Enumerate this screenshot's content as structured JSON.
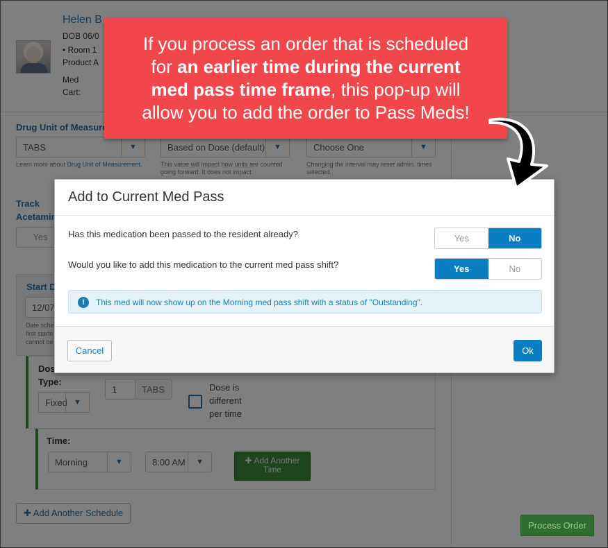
{
  "resident": {
    "name": "Helen B",
    "dob": "DOB 06/0",
    "room": "• Room 1",
    "product": "Product A",
    "med_label": "Med",
    "cart_label": "Cart:"
  },
  "order_form": {
    "drug_unit_label": "Drug Unit of Measure",
    "drug_unit_value": "TABS",
    "drug_unit_help_prefix": "Learn more about ",
    "drug_unit_help_link": "Drug Unit of Measurement.",
    "count_value": "Based on Dose (default)",
    "count_help": "This value will impact how units are counted going forward. It does not impact",
    "interval_value": "Choose One",
    "interval_help": "Changing the interval may reset admin. times selected.",
    "track_label_1": "Track",
    "track_label_2": "Acetamin",
    "track_yes": "Yes",
    "start_label": "Start D",
    "start_value": "12/07",
    "start_help_1": "Date sche",
    "start_help_2": "first starte",
    "start_help_3": "cannot be",
    "dose_label_1": "Dos",
    "dose_label_2": "Type:",
    "dose_type_value": "Fixed",
    "dose_qty": "1",
    "dose_unit": "TABS",
    "dose_diff_1": "Dose is",
    "dose_diff_2": "different",
    "dose_diff_3": "per time",
    "time_label": "Time:",
    "time_period": "Morning",
    "time_value": "8:00 AM",
    "add_time_1": "✚ Add Another",
    "add_time_2": "Time",
    "add_schedule": "✚ Add Another Schedule",
    "process_order": "Process Order"
  },
  "callout": {
    "line1": "If you process an order that is scheduled",
    "line2_pre": "for ",
    "line2_bold": "an earlier time during the current",
    "line3_bold": "med pass time frame",
    "line3_post": ", this pop-up will",
    "line4": "allow you to add the order to Pass Meds!"
  },
  "modal": {
    "title": "Add to Current Med Pass",
    "q1": "Has this medication been passed to the resident already?",
    "q1_yes": "Yes",
    "q1_no": "No",
    "q1_selected": "No",
    "q2": "Would you like to add this medication to the current med pass shift?",
    "q2_yes": "Yes",
    "q2_no": "No",
    "q2_selected": "Yes",
    "info_icon": "!",
    "info_text": "This med will now show up on the Morning med pass shift with a status of \"Outstanding\".",
    "cancel": "Cancel",
    "ok": "Ok"
  },
  "colors": {
    "accent": "#0b7ec1",
    "callout": "#f2474a",
    "info_bg": "#e4f2f7",
    "green": "#3c8a3c"
  },
  "icons": [
    "chevron-down-icon",
    "info-icon",
    "curved-arrow-icon",
    "plus-icon",
    "checkbox-icon"
  ]
}
